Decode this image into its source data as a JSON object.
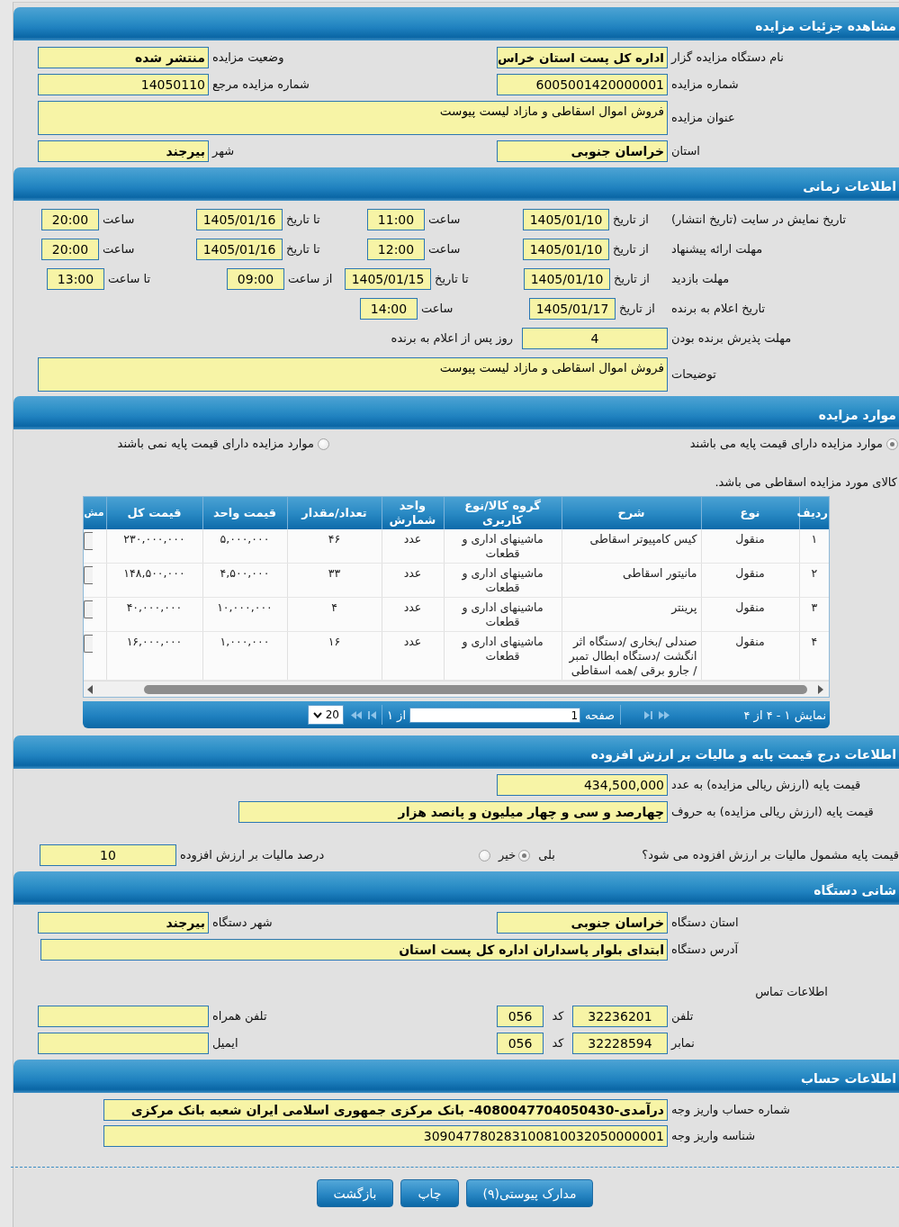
{
  "details": {
    "title": "مشاهده جزئیات مزایده",
    "rows": [
      {
        "kind": "pair",
        "fields": [
          {
            "label": "نام دستگاه مزایده گزار",
            "value": "اداره کل پست استان خراس",
            "bold": true
          },
          {
            "label": "وضعیت مزایده",
            "value": "منتشر شده",
            "bold": true
          }
        ]
      },
      {
        "kind": "pair",
        "fields": [
          {
            "label": "شماره مزایده",
            "value": "6005001420000001",
            "bold": false
          },
          {
            "label": "شماره مزایده مرجع",
            "value": "14050110",
            "bold": false
          }
        ]
      },
      {
        "kind": "textarea",
        "label": "عنوان مزایده",
        "value": "فروش اموال اسقاطی و مازاد لیست پیوست",
        "bold": false
      },
      {
        "kind": "pair",
        "fields": [
          {
            "label": "استان",
            "value": "خراسان جنوبی",
            "bold": true
          },
          {
            "label": "شهر",
            "value": "بیرجند",
            "bold": true
          }
        ]
      }
    ]
  },
  "schedule": {
    "title": "اطلاعات زمانی",
    "rows": [
      {
        "kind": "range",
        "label": "تاریخ نمایش در سایت (تاریخ انتشار)",
        "parts": [
          {
            "prefix": "از تاریخ",
            "value": "1405/01/10",
            "kind": "date"
          },
          {
            "prefix": "ساعت",
            "value": "11:00",
            "kind": "time"
          },
          {
            "prefix": "تا تاریخ",
            "value": "1405/01/16",
            "kind": "date"
          },
          {
            "prefix": "ساعت",
            "value": "20:00",
            "kind": "time"
          }
        ]
      },
      {
        "kind": "range",
        "label": "مهلت ارائه پیشنهاد",
        "parts": [
          {
            "prefix": "از تاریخ",
            "value": "1405/01/10",
            "kind": "date"
          },
          {
            "prefix": "ساعت",
            "value": "12:00",
            "kind": "time"
          },
          {
            "prefix": "تا تاریخ",
            "value": "1405/01/16",
            "kind": "date"
          },
          {
            "prefix": "ساعت",
            "value": "20:00",
            "kind": "time"
          }
        ]
      },
      {
        "kind": "visit",
        "label": "مهلت بازدید",
        "parts": [
          {
            "prefix": "از تاریخ",
            "value": "1405/01/10",
            "kind": "date"
          },
          {
            "prefix": "تا تاریخ",
            "value": "1405/01/15",
            "kind": "date"
          },
          {
            "prefix": "از ساعت",
            "value": "09:00",
            "kind": "time"
          },
          {
            "prefix": "تا ساعت",
            "value": "13:00",
            "kind": "time"
          }
        ]
      },
      {
        "kind": "announce",
        "label": "تاریخ اعلام به برنده",
        "parts": [
          {
            "prefix": "از تاریخ",
            "value": "1405/01/17",
            "kind": "date"
          },
          {
            "prefix": "ساعت",
            "value": "14:00",
            "kind": "time"
          }
        ]
      },
      {
        "kind": "days",
        "label": "مهلت پذیرش برنده بودن",
        "value": "4",
        "suffix": "روز پس از اعلام به برنده"
      },
      {
        "kind": "textarea",
        "label": "توضیحات",
        "value": "فروش اموال اسقاطی و مازاد لیست پیوست",
        "bold": false
      }
    ]
  },
  "items": {
    "title": "موارد مزایده",
    "options": [
      {
        "label": "موارد مزایده دارای قیمت پایه می باشند",
        "selected": true
      },
      {
        "label": "موارد مزایده دارای قیمت پایه نمی باشند",
        "selected": false
      }
    ],
    "note": "کالای مورد مزایده اسقاطی می باشد.",
    "table": {
      "columns": [
        "ردیف",
        "نوع",
        "شرح",
        "گروه کالا/نوع کاربری",
        "واحد شمارش",
        "تعداد/مقدار",
        "قیمت واحد",
        "قیمت کل",
        "مش"
      ],
      "rows": [
        [
          "۱",
          "منقول",
          "کیس کامپیوتر اسقاطی",
          "ماشینهای اداری و قطعات",
          "عدد",
          "۴۶",
          "۵,۰۰۰,۰۰۰",
          "۲۳۰,۰۰۰,۰۰۰"
        ],
        [
          "۲",
          "منقول",
          "مانیتور اسقاطی",
          "ماشینهای اداری و قطعات",
          "عدد",
          "۳۳",
          "۴,۵۰۰,۰۰۰",
          "۱۴۸,۵۰۰,۰۰۰"
        ],
        [
          "۳",
          "منقول",
          "پرینتر",
          "ماشینهای اداری و قطعات",
          "عدد",
          "۴",
          "۱۰,۰۰۰,۰۰۰",
          "۴۰,۰۰۰,۰۰۰"
        ],
        [
          "۴",
          "منقول",
          "صندلی /بخاری /دستگاه اثر انگشت /دستگاه ابطال تمبر / جارو برقی /همه اسقاطی",
          "ماشینهای اداری و قطعات",
          "عدد",
          "۱۶",
          "۱,۰۰۰,۰۰۰",
          "۱۶,۰۰۰,۰۰۰"
        ]
      ]
    },
    "pager": {
      "summary": "نمایش ۱ - ۴ از ۴",
      "page_label": "صفحه",
      "page": "1",
      "of": "از ۱",
      "page_size": "20"
    }
  },
  "pricing": {
    "title": "اطلاعات درج قیمت پایه و مالیات بر ارزش افزوده",
    "amount": {
      "label": "قیمت پایه (ارزش ریالی مزایده) به عدد",
      "value": "434,500,000",
      "bold": false
    },
    "amount_words": {
      "label": "قیمت پایه (ارزش ریالی مزایده) به حروف",
      "value": "چهارصد و سی و چهار میلیون و پانصد هزار",
      "bold": true
    },
    "vat_question": {
      "label": "قیمت پایه مشمول مالیات بر ارزش افزوده می شود؟",
      "options": [
        {
          "label": "بلی",
          "selected": true
        },
        {
          "label": "خیر",
          "selected": false
        }
      ]
    },
    "vat_percent": {
      "label": "درصد مالیات بر ارزش افزوده",
      "value": "10"
    }
  },
  "agency": {
    "title": "شانی دستگاه",
    "rows": [
      {
        "kind": "pair",
        "fields": [
          {
            "label": "استان دستگاه",
            "value": "خراسان جنوبی",
            "bold": true
          },
          {
            "label": "شهر دستگاه",
            "value": "بیرجند",
            "bold": true
          }
        ]
      }
    ],
    "address": {
      "label": "آدرس دستگاه",
      "value": "ابتدای بلوار پاسداران اداره کل پست استان",
      "bold": true
    },
    "contact_title": "اطلاعات تماس",
    "contacts": [
      {
        "label": "تلفن",
        "value": "32236201",
        "code_label": "کد",
        "code": "056",
        "other_label": "تلفن همراه"
      },
      {
        "label": "نمابر",
        "value": "32228594",
        "code_label": "کد",
        "code": "056",
        "other_label": "ایمیل"
      }
    ]
  },
  "account": {
    "title": "اطلاعات حساب",
    "fields": [
      {
        "label": "شماره حساب واریز وجه",
        "value": "درآمدی-4080047704050430- بانک مرکزی جمهوری اسلامی ایران شعبه بانک مرکزی",
        "bold": true
      },
      {
        "label": "شناسه واریز وجه",
        "value": "309047780283100810032050000001",
        "bold": false
      }
    ]
  },
  "buttons": [
    "مدارک پیوستی(۹)",
    "چاپ",
    "بازگشت"
  ]
}
